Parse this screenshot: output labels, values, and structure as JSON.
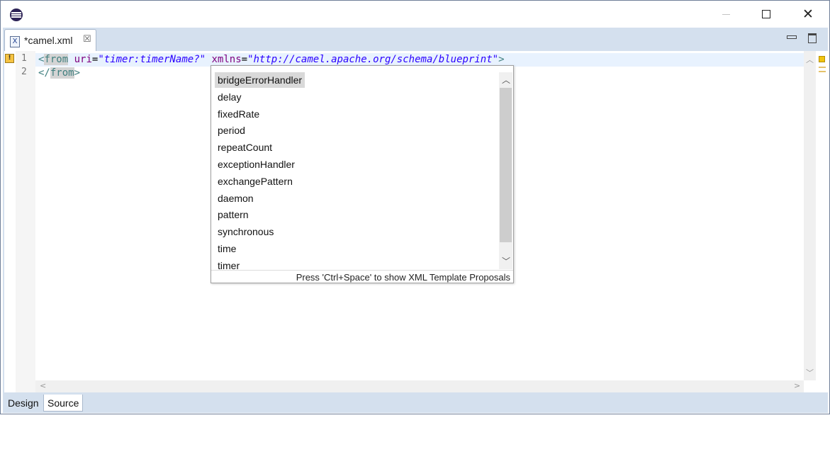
{
  "window": {
    "icon": "eclipse-icon",
    "controls": {
      "minimize": "—",
      "maximize": "☐",
      "close": "✕"
    }
  },
  "editor_tab": {
    "file_icon": "xml-file-icon",
    "icon_glyph": "X",
    "title": "*camel.xml",
    "close_glyph": "☒"
  },
  "code": {
    "line_numbers": [
      "1",
      "2"
    ],
    "line1": {
      "open": "<",
      "tag": "from",
      "attr1": "uri",
      "eq1": "=",
      "val1": "\"timer:timerName?\"",
      "attr2": "xmlns",
      "eq2": "=",
      "val2": "\"http://camel.apache.org/schema/blueprint\"",
      "close": ">"
    },
    "line2": {
      "open": "</",
      "tag": "from",
      "close": ">"
    }
  },
  "content_assist": {
    "proposals": [
      "bridgeErrorHandler",
      "delay",
      "fixedRate",
      "period",
      "repeatCount",
      "exceptionHandler",
      "exchangePattern",
      "daemon",
      "pattern",
      "synchronous",
      "time",
      "timer"
    ],
    "selected_index": 0,
    "footer": "Press 'Ctrl+Space' to show XML Template Proposals"
  },
  "bottom_tabs": [
    "Design",
    "Source"
  ],
  "active_bottom_tab": "Source",
  "colors": {
    "tag": "#3f7f7f",
    "attribute": "#7f007f",
    "value": "#2a00ff",
    "frame": "#d4e0ee"
  }
}
